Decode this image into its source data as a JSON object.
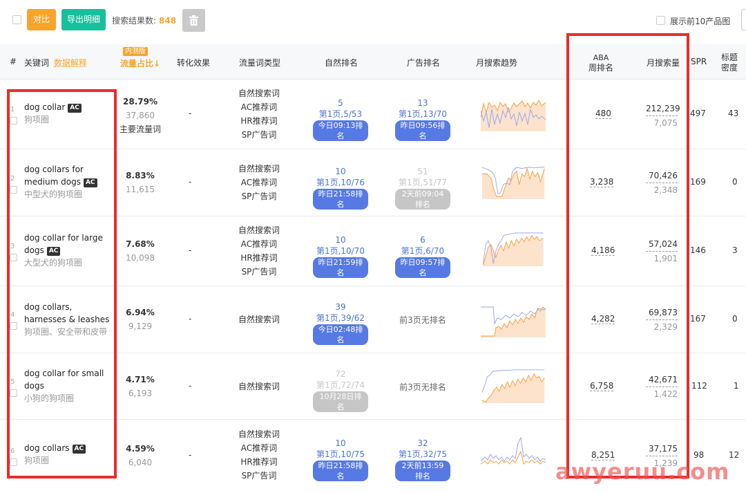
{
  "toolbar": {
    "compare_label": "对比",
    "export_label": "导出明细",
    "result_label": "搜索结果数:",
    "result_count": "848",
    "top10_label": "展示前10产品图"
  },
  "header": {
    "col_index": "#",
    "col_keyword": "关键词",
    "col_keyword_link": "数据解释",
    "col_flow_badge": "内测版",
    "col_flow": "流量占比↓",
    "col_conversion": "转化效果",
    "col_type": "流量词类型",
    "col_organic": "自然排名",
    "col_ad": "广告排名",
    "col_trend": "月搜索趋势",
    "col_aba_1": "ABA",
    "col_aba_2": "周排名",
    "col_volume": "月搜索量",
    "col_spr": "SPR",
    "col_title_1": "标题",
    "col_title_2": "密度"
  },
  "rows": [
    {
      "index": "1",
      "keyword": "dog collar",
      "ac": "AC",
      "cn": "狗项圈",
      "pct": "28.79%",
      "flow": "37,860",
      "main": "主要流量词",
      "conversion": "-",
      "types": [
        "自然搜索词",
        "AC推荐词",
        "HR推荐词",
        "SP广告词"
      ],
      "organic": {
        "rank": "5",
        "page": "第1页,5/53",
        "time": "今日09:13排名"
      },
      "ad": {
        "rank": "13",
        "page": "第1页,13/70",
        "time": "昨日09:56排名"
      },
      "aba": "480",
      "volume": "212,239",
      "volume_sub": "7,075",
      "spr": "497",
      "density": "43"
    },
    {
      "index": "2",
      "keyword": "dog collars for medium dogs",
      "ac": "AC",
      "cn": "中型犬的狗项圈",
      "pct": "8.83%",
      "flow": "11,615",
      "conversion": "-",
      "types": [
        "自然搜索词",
        "AC推荐词",
        "SP广告词"
      ],
      "organic": {
        "rank": "10",
        "page": "第1页,10/76",
        "time": "昨日21:58排名"
      },
      "ad": {
        "rank": "51",
        "page": "第1页,51/77",
        "time": "2天前09:04排名"
      },
      "aba": "3,238",
      "volume": "70,426",
      "volume_sub": "2,348",
      "spr": "169",
      "density": "0"
    },
    {
      "index": "3",
      "keyword": "dog collar for large dogs",
      "ac": "AC",
      "cn": "大型犬的狗项圈",
      "pct": "7.68%",
      "flow": "10,098",
      "conversion": "-",
      "types": [
        "自然搜索词",
        "AC推荐词",
        "HR推荐词",
        "SP广告词"
      ],
      "organic": {
        "rank": "10",
        "page": "第1页,10/70",
        "time": "昨日21:59排名"
      },
      "ad": {
        "rank": "6",
        "page": "第1页,6/70",
        "time": "昨日09:57排名"
      },
      "aba": "4,186",
      "volume": "57,024",
      "volume_sub": "1,901",
      "spr": "146",
      "density": "3"
    },
    {
      "index": "4",
      "keyword": "dog collars, harnesses & leashes",
      "cn": "狗项圈、安全带和皮带",
      "pct": "6.94%",
      "flow": "9,129",
      "conversion": "-",
      "types": [
        "自然搜索词"
      ],
      "organic": {
        "rank": "39",
        "page": "第1页,39/62",
        "time": "今日02:48排名"
      },
      "ad_none": "前3页无排名",
      "aba": "4,282",
      "volume": "69,873",
      "volume_sub": "2,329",
      "spr": "167",
      "density": "0"
    },
    {
      "index": "5",
      "keyword": "dog collar for small dogs",
      "cn": "小狗的狗项圈",
      "pct": "4.71%",
      "flow": "6,193",
      "conversion": "-",
      "types": [
        "自然搜索词"
      ],
      "organic": {
        "rank": "72",
        "page": "第1页,72/74",
        "time": "10月28日排名"
      },
      "ad_none": "前3页无排名",
      "aba": "6,758",
      "volume": "42,671",
      "volume_sub": "1,422",
      "spr": "112",
      "density": "1"
    },
    {
      "index": "6",
      "keyword": "dog collars",
      "ac": "AC",
      "cn": "狗项圈",
      "pct": "4.59%",
      "flow": "6,040",
      "conversion": "-",
      "types": [
        "自然搜索词",
        "AC推荐词",
        "HR推荐词",
        "SP广告词"
      ],
      "organic": {
        "rank": "10",
        "page": "第1页,10/75",
        "time": "昨日21:58排名"
      },
      "ad": {
        "rank": "32",
        "page": "第1页,32/75",
        "time": "2天前13:59排名"
      },
      "aba": "8,251",
      "volume": "37,175",
      "volume_sub": "1,239",
      "spr": "98",
      "density": "12"
    }
  ],
  "watermark": "awyeruu.com",
  "colors": {
    "orange": "#f7a42d",
    "green": "#19be9c",
    "blue": "#4a74d6",
    "pill_blue": "#5779e3",
    "red_box": "#ee2a2a"
  }
}
